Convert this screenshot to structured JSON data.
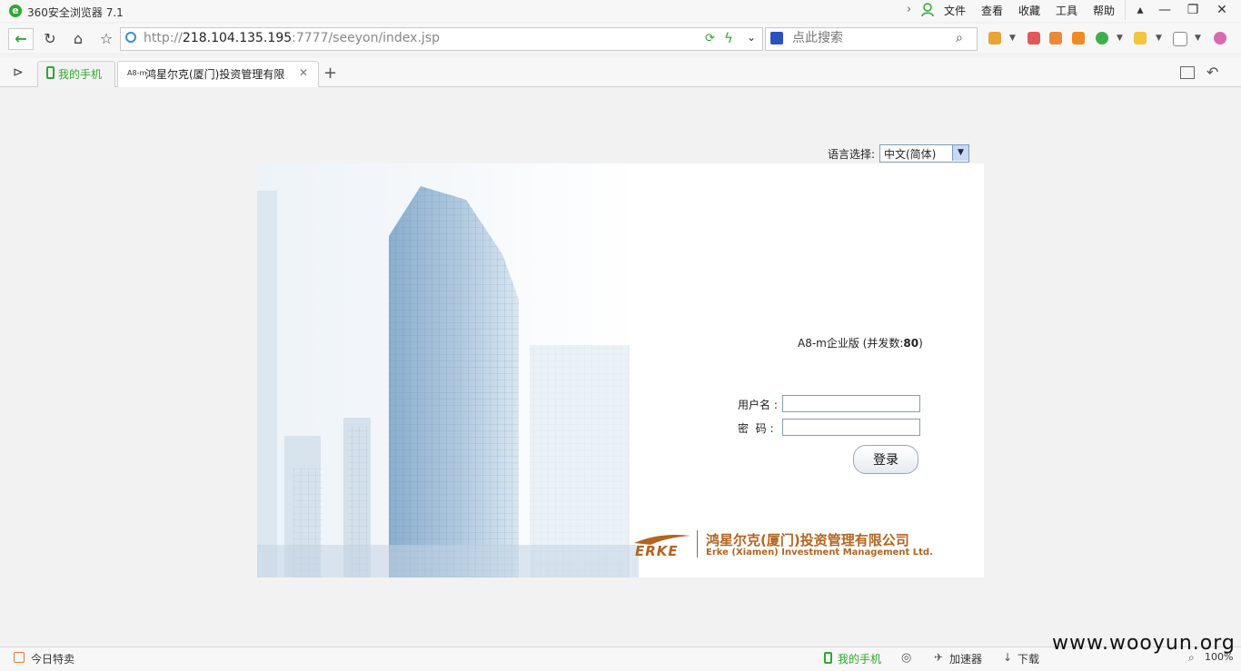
{
  "browser": {
    "title": "360安全浏览器 7.1",
    "menu": [
      "文件",
      "查看",
      "收藏",
      "工具",
      "帮助"
    ],
    "window_buttons": [
      "minimize",
      "restore",
      "close"
    ],
    "address": {
      "scheme": "http://",
      "host": "218.104.135.195",
      "rest": ":7777/seeyon/index.jsp"
    },
    "search_placeholder": "点此搜索",
    "tabs": [
      {
        "label": "我的手机",
        "active": false
      },
      {
        "label": "鸿星尔克(厦门)投资管理有限",
        "favicon_text": "A8-m",
        "active": true
      }
    ],
    "new_tab": "+"
  },
  "page": {
    "language_label": "语言选择:",
    "language_value": "中文(简体)",
    "edition_prefix": "A8-m企业版 (并发数:",
    "edition_count": "80",
    "edition_suffix": ")",
    "username_label": "用户名 :",
    "password_label": "密  码 :",
    "login_button": "登录",
    "company_name_cn": "鸿星尔克(厦门)投资管理有限公司",
    "company_name_en": "Erke (Xiamen) Investment Management Ltd.",
    "brand": "ERKE",
    "accent_color": "#b4641e"
  },
  "statusbar": {
    "left": "今日特卖",
    "phone": "我的手机",
    "accelerator": "加速器",
    "download": "下载",
    "zoom": "100%"
  },
  "watermark": "www.wooyun.org"
}
